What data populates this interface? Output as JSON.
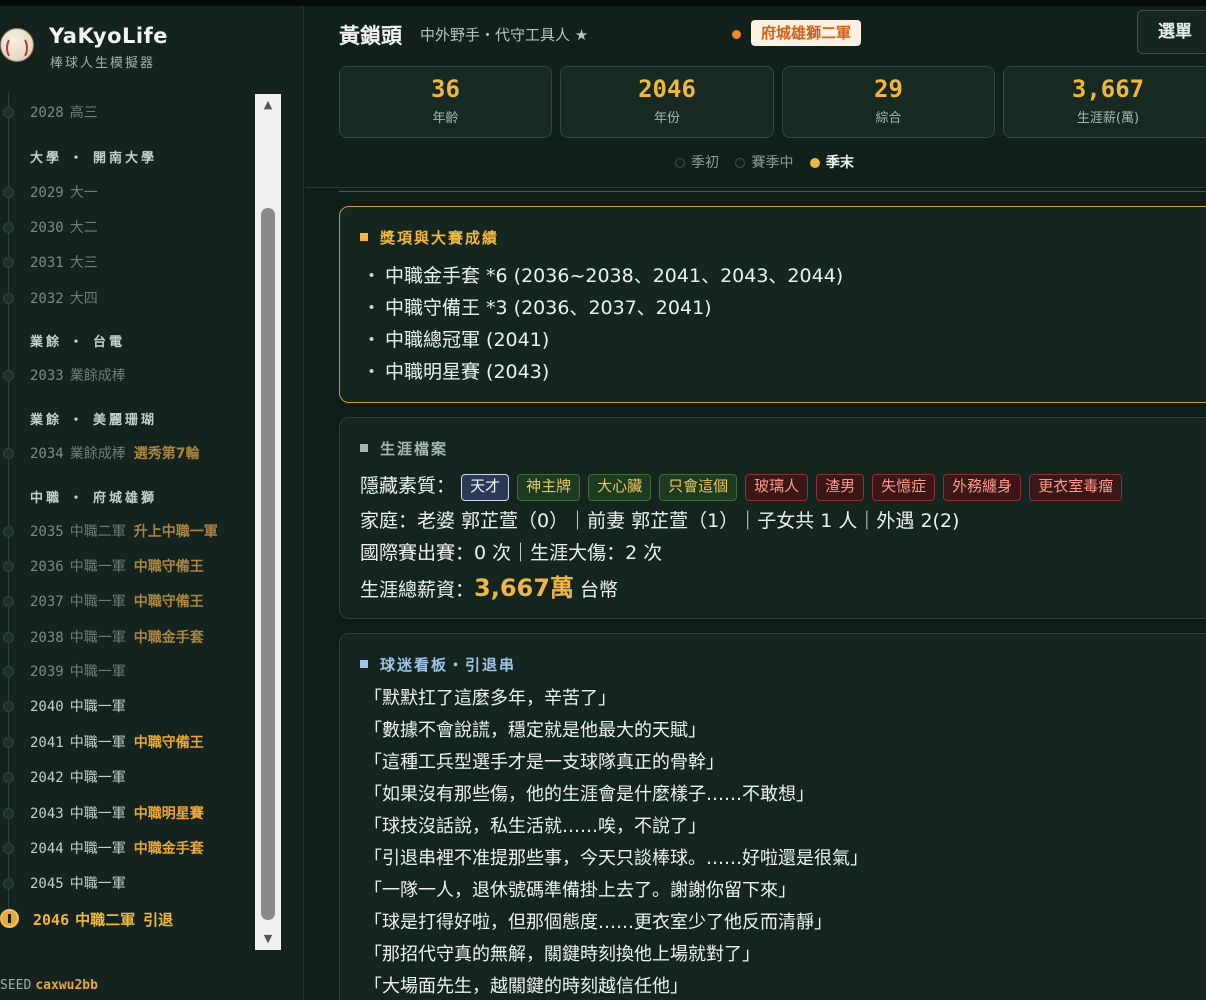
{
  "app": {
    "name": "YaKyoLife",
    "subtitle": "棒球人生模擬器"
  },
  "player": {
    "name": "黃鎖頭",
    "role": "中外野手・代守工具人 ★",
    "team": "府城雄獅二軍"
  },
  "header": {
    "menu_label": "選單"
  },
  "stats": [
    {
      "value": "36",
      "label": "年齡"
    },
    {
      "value": "2046",
      "label": "年份"
    },
    {
      "value": "29",
      "label": "綜合"
    },
    {
      "value": "3,667",
      "label": "生涯薪(萬)"
    }
  ],
  "phases": [
    {
      "label": "季初",
      "active": false
    },
    {
      "label": "賽季中",
      "active": false
    },
    {
      "label": "季末",
      "active": true
    }
  ],
  "timeline": {
    "items": [
      {
        "year": "2028",
        "text": "高三",
        "event": ""
      },
      {
        "group": "大學 ・ 開南大學"
      },
      {
        "year": "2029",
        "text": "大一",
        "event": ""
      },
      {
        "year": "2030",
        "text": "大二",
        "event": ""
      },
      {
        "year": "2031",
        "text": "大三",
        "event": ""
      },
      {
        "year": "2032",
        "text": "大四",
        "event": ""
      },
      {
        "group": "業餘 ・ 台電"
      },
      {
        "year": "2033",
        "text": "業餘成棒",
        "event": ""
      },
      {
        "group": "業餘 ・ 美麗珊瑚"
      },
      {
        "year": "2034",
        "text": "業餘成棒",
        "event": "選秀第7輪"
      },
      {
        "group": "中職 ・ 府城雄獅"
      },
      {
        "year": "2035",
        "text": "中職二軍",
        "event": "升上中職一軍"
      },
      {
        "year": "2036",
        "text": "中職一軍",
        "event": "中職守備王"
      },
      {
        "year": "2037",
        "text": "中職一軍",
        "event": "中職守備王"
      },
      {
        "year": "2038",
        "text": "中職一軍",
        "event": "中職金手套"
      },
      {
        "year": "2039",
        "text": "中職一軍",
        "event": ""
      },
      {
        "year": "2040",
        "text": "中職一軍",
        "event": ""
      },
      {
        "year": "2041",
        "text": "中職一軍",
        "event": "中職守備王"
      },
      {
        "year": "2042",
        "text": "中職一軍",
        "event": ""
      },
      {
        "year": "2043",
        "text": "中職一軍",
        "event": "中職明星賽"
      },
      {
        "year": "2044",
        "text": "中職一軍",
        "event": "中職金手套"
      },
      {
        "year": "2045",
        "text": "中職一軍",
        "event": ""
      },
      {
        "year": "2046",
        "text": "中職二軍",
        "event": "引退",
        "current": true
      }
    ]
  },
  "seed": {
    "label": "SEED",
    "value": "caxwu2bb"
  },
  "awards": {
    "title": "獎項與大賽成績",
    "items": [
      "中職金手套 *6 (2036~2038、2041、2043、2044)",
      "中職守備王 *3 (2036、2037、2041)",
      "中職總冠軍 (2041)",
      "中職明星賽 (2043)"
    ]
  },
  "career": {
    "title": "生涯檔案",
    "traits_label": "隱藏素質：",
    "traits": [
      {
        "label": "天才",
        "kind": "genius"
      },
      {
        "label": "神主牌",
        "kind": "good"
      },
      {
        "label": "大心臟",
        "kind": "good"
      },
      {
        "label": "只會這個",
        "kind": "good"
      },
      {
        "label": "玻璃人",
        "kind": "bad"
      },
      {
        "label": "渣男",
        "kind": "bad"
      },
      {
        "label": "失憶症",
        "kind": "bad"
      },
      {
        "label": "外務纏身",
        "kind": "bad"
      },
      {
        "label": "更衣室毒瘤",
        "kind": "bad"
      }
    ],
    "family": "家庭：老婆 郭芷萱（0）｜前妻 郭芷萱（1）｜子女共 1 人｜外遇 2(2)",
    "international": "國際賽出賽：0 次｜生涯大傷：2 次",
    "salary_label": "生涯總薪資：",
    "salary_value": "3,667萬",
    "salary_unit": "台幣"
  },
  "fans": {
    "title": "球迷看板・引退串",
    "quotes": [
      "「默默扛了這麼多年，辛苦了」",
      "「數據不會說謊，穩定就是他最大的天賦」",
      "「這種工兵型選手才是一支球隊真正的骨幹」",
      "「如果沒有那些傷，他的生涯會是什麼樣子……不敢想」",
      "「球技沒話說，私生活就……唉，不說了」",
      "「引退串裡不准提那些事，今天只談棒球。……好啦還是很氣」",
      "「一隊一人，退休號碼準備掛上去了。謝謝你留下來」",
      "「球是打得好啦，但那個態度……更衣室少了他反而清靜」",
      "「那招代守真的無解，關鍵時刻換他上場就對了」",
      "「大場面先生，越關鍵的時刻越信任他」"
    ]
  }
}
